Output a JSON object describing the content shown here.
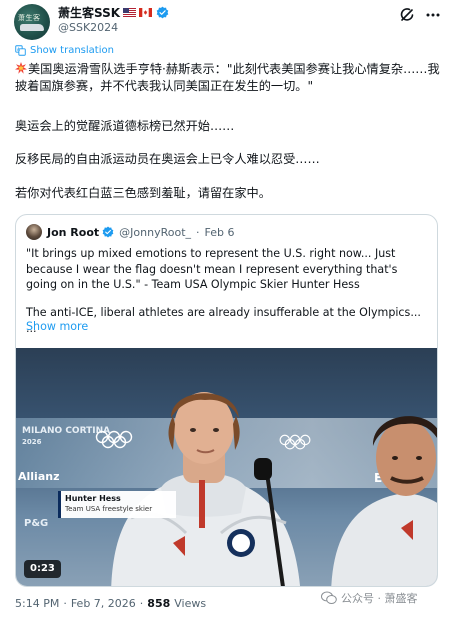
{
  "author": {
    "display_name": "萧生客SSK",
    "handle": "@SSK2024",
    "avatar_text": "萧生客",
    "flags": [
      "us-flag",
      "ca-flag"
    ]
  },
  "header_actions": {
    "grok_icon": "grok-icon",
    "more_icon": "more-icon"
  },
  "translate": {
    "label": "Show translation"
  },
  "body": {
    "p1": "美国奥运滑雪队选手亨特·赫斯表示：\"此刻代表美国参赛让我心情复杂……我披着国旗参赛，并不代表我认同美国正在发生的一切。\"",
    "p2": "奥运会上的觉醒派道德标榜已然开始……",
    "p3": "反移民局的自由派运动员在奥运会上已令人难以忍受……",
    "p4": "若你对代表红白蓝三色感到羞耻，请留在家中。"
  },
  "quote": {
    "name": "Jon Root",
    "handle": "@JonnyRoot_",
    "separator": "·",
    "date": "Feb 6",
    "text1": "\"It brings up mixed emotions to represent the U.S. right now... Just because I wear the flag doesn't mean I represent everything that's going on in the U.S.\" - Team USA Olympic Skier Hunter Hess",
    "text2": "The anti-ICE, liberal athletes are already insufferable at the Olympics... ...",
    "show_more": "Show more",
    "media": {
      "name_tag_name": "Hunter Hess",
      "name_tag_sub": "Team USA freestyle skier",
      "duration": "0:23",
      "background_text": [
        "MILANO CORTINA",
        "2026",
        "Allianz",
        "Eloitte.",
        "P&G"
      ]
    }
  },
  "footer": {
    "time": "5:14 PM",
    "dot1": "·",
    "date": "Feb 7, 2026",
    "dot2": "·",
    "views_count": "858",
    "views_label": "Views"
  },
  "watermark": {
    "text": "公众号 · 萧盛客"
  },
  "colors": {
    "accent": "#1d9bf0",
    "muted": "#536471",
    "text": "#0f1419",
    "border": "#cfd9de"
  }
}
